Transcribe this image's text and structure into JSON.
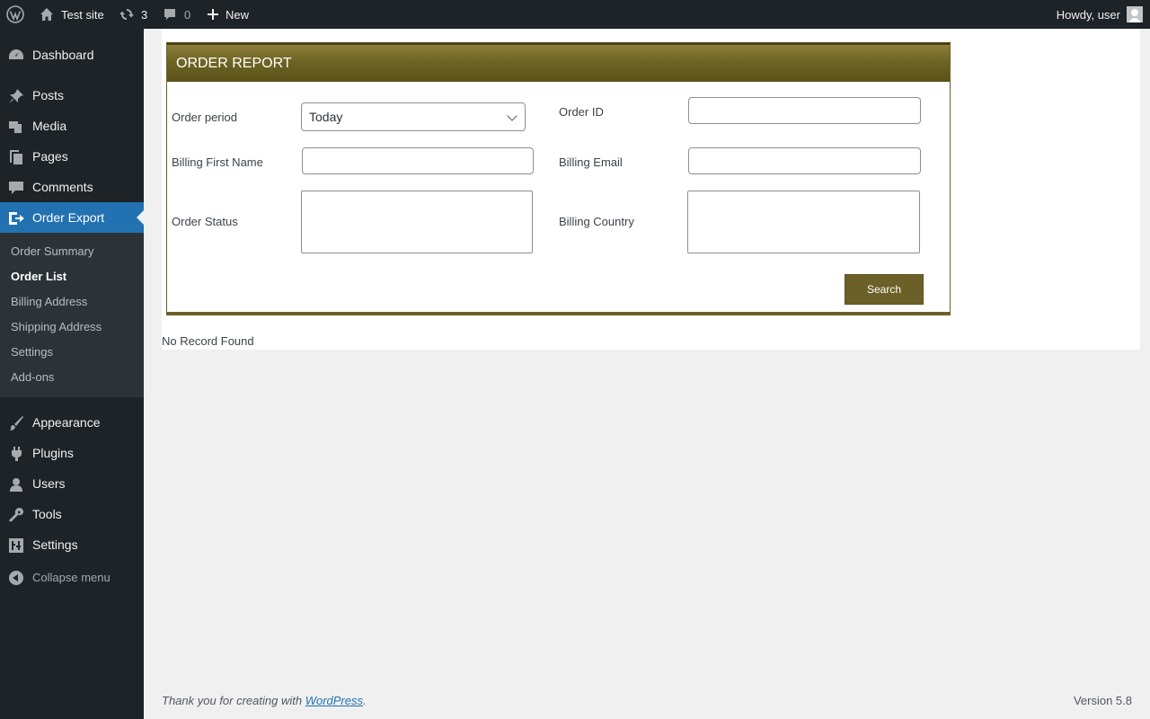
{
  "adminbar": {
    "site_name": "Test site",
    "updates_count": "3",
    "comments_count": "0",
    "new_label": "New",
    "howdy": "Howdy, user"
  },
  "sidebar": {
    "items": [
      {
        "label": "Dashboard",
        "icon": "dashboard-icon"
      },
      {
        "label": "Posts",
        "icon": "pin-icon"
      },
      {
        "label": "Media",
        "icon": "media-icon"
      },
      {
        "label": "Pages",
        "icon": "pages-icon"
      },
      {
        "label": "Comments",
        "icon": "comment-icon"
      },
      {
        "label": "Order Export",
        "icon": "export-icon"
      },
      {
        "label": "Appearance",
        "icon": "brush-icon"
      },
      {
        "label": "Plugins",
        "icon": "plug-icon"
      },
      {
        "label": "Users",
        "icon": "user-icon"
      },
      {
        "label": "Tools",
        "icon": "wrench-icon"
      },
      {
        "label": "Settings",
        "icon": "sliders-icon"
      }
    ],
    "submenu": [
      "Order Summary",
      "Order List",
      "Billing Address",
      "Shipping Address",
      "Settings",
      "Add-ons"
    ],
    "collapse_label": "Collapse menu"
  },
  "report": {
    "title": "ORDER REPORT",
    "order_period_label": "Order period",
    "order_period_value": "Today",
    "order_id_label": "Order ID",
    "billing_first_name_label": "Billing First Name",
    "billing_email_label": "Billing Email",
    "order_status_label": "Order Status",
    "billing_country_label": "Billing Country",
    "search_label": "Search"
  },
  "results": {
    "empty_text": "No Record Found"
  },
  "footer": {
    "thanks_prefix": "Thank you for creating with ",
    "thanks_link": "WordPress",
    "thanks_suffix": ".",
    "version": "Version 5.8"
  },
  "colors": {
    "accent": "#2271b1",
    "report_header": "#6e6424",
    "sidebar_bg": "#1d2327"
  }
}
